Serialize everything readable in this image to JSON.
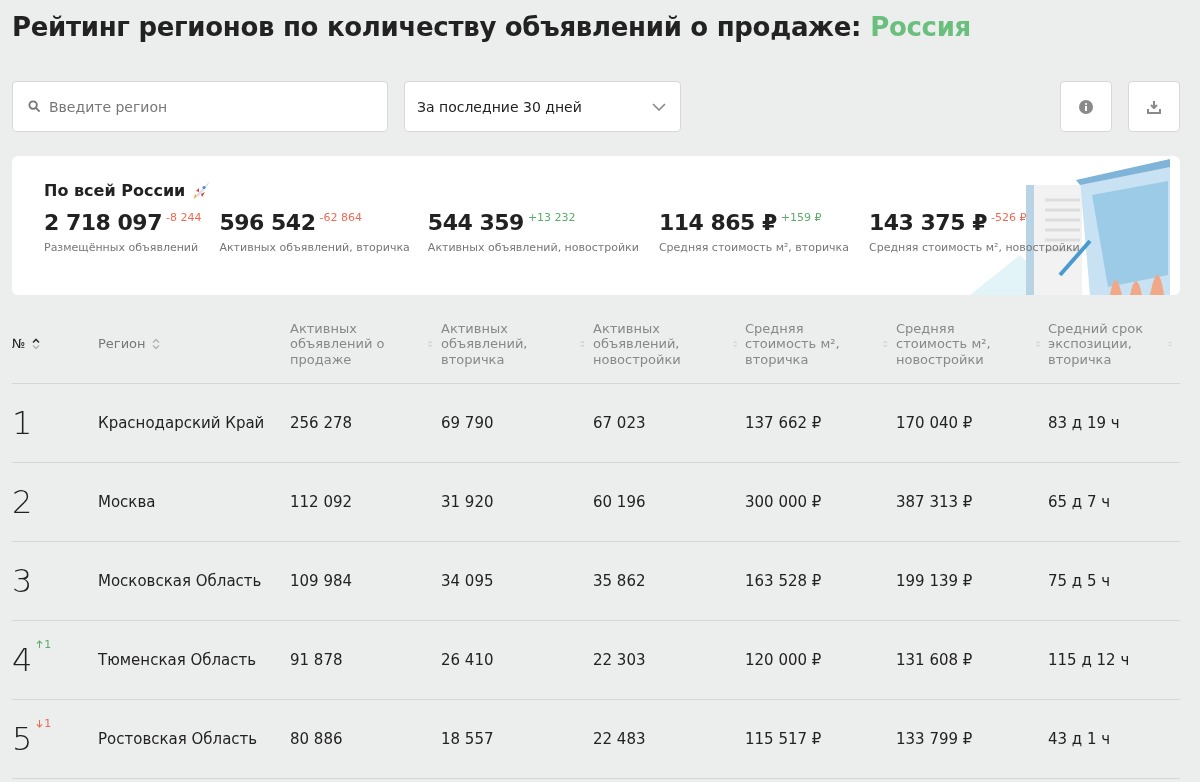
{
  "title": {
    "text": "Рейтинг регионов по количеству объявлений о продаже:",
    "highlight": "Россия"
  },
  "search": {
    "placeholder": "Введите регион"
  },
  "period": {
    "value": "За последние 30 дней"
  },
  "summary": {
    "title": "По всей России",
    "stats": [
      {
        "value": "2 718 097",
        "delta": "-8 244",
        "rising": false,
        "label": "Размещённых объявлений"
      },
      {
        "value": "596 542",
        "delta": "-62 864",
        "rising": false,
        "label": "Активных объявлений, вторичка"
      },
      {
        "value": "544 359",
        "delta": "+13 232",
        "rising": true,
        "label": "Активных объявлений, новостройки"
      },
      {
        "value": "114 865 ₽",
        "delta": "+159 ₽",
        "rising": true,
        "label": "Средняя стоимость м², вторичка"
      },
      {
        "value": "143 375 ₽",
        "delta": "-526 ₽",
        "rising": false,
        "label": "Средняя стоимость м², новостройки"
      }
    ]
  },
  "table": {
    "columns": [
      {
        "label": "№",
        "sorted": true
      },
      {
        "label": "Регион",
        "sorted": false
      },
      {
        "label": "Активных объявлений о продаже",
        "sorted": false
      },
      {
        "label": "Активных объявлений, вторичка",
        "sorted": false
      },
      {
        "label": "Активных объявлений, новостройки",
        "sorted": false
      },
      {
        "label": "Средняя стоимость м², вторичка",
        "sorted": false
      },
      {
        "label": "Средняя стоимость м², новостройки",
        "sorted": false
      },
      {
        "label": "Средний срок экспозиции, вторичка",
        "sorted": false
      }
    ],
    "rows": [
      {
        "cells": [
          "1",
          "Краснодарский Край",
          "256 278",
          "69 790",
          "67 023",
          "137 662 ₽",
          "170 040 ₽",
          "83 д 19 ч"
        ]
      },
      {
        "cells": [
          "2",
          "Москва",
          "112 092",
          "31 920",
          "60 196",
          "300 000 ₽",
          "387 313 ₽",
          "65 д 7 ч"
        ]
      },
      {
        "cells": [
          "3",
          "Московская Область",
          "109 984",
          "34 095",
          "35 862",
          "163 528 ₽",
          "199 139 ₽",
          "75 д 5 ч"
        ]
      },
      {
        "change": {
          "rising": true,
          "text": "1"
        },
        "cells": [
          "4",
          "Тюменская Область",
          "91 878",
          "26 410",
          "22 303",
          "120 000 ₽",
          "131 608 ₽",
          "115 д 12 ч"
        ]
      },
      {
        "change": {
          "rising": false,
          "text": "1"
        },
        "cells": [
          "5",
          "Ростовская Область",
          "80 886",
          "18 557",
          "22 483",
          "115 517 ₽",
          "133 799 ₽",
          "43 д 1 ч"
        ]
      }
    ]
  }
}
